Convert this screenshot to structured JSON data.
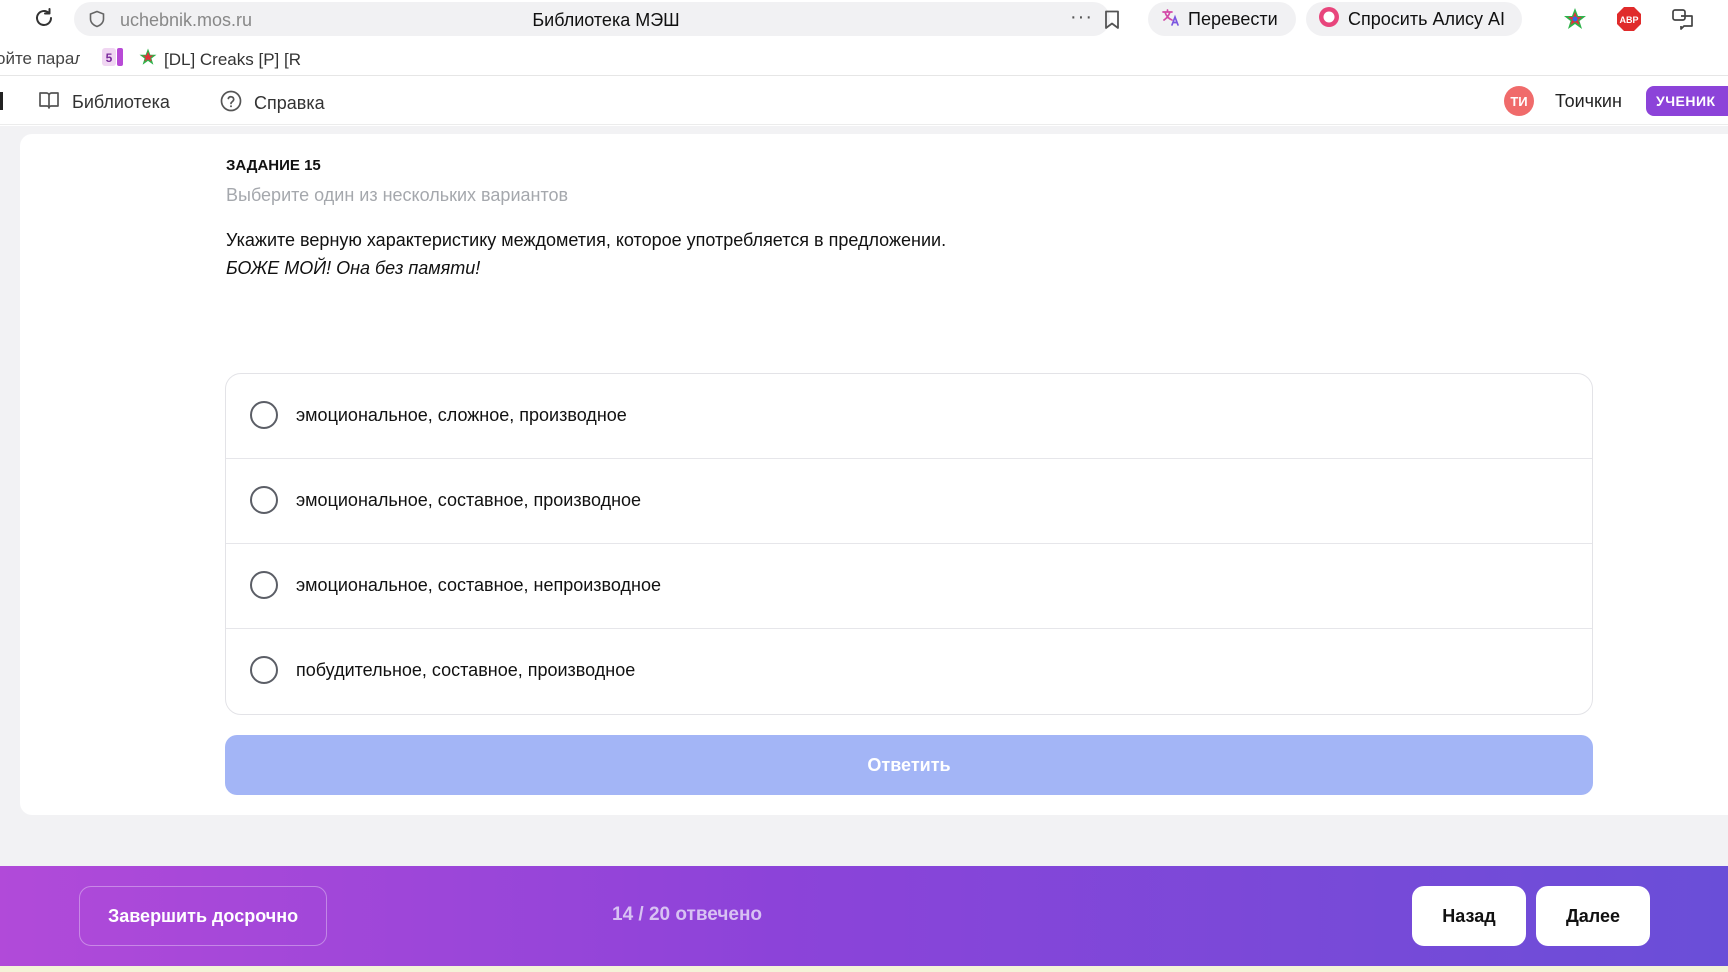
{
  "browser": {
    "url": "uchebnik.mos.ru",
    "tab_title": "Библиотека МЭШ",
    "more_label": "···",
    "translate_label": "Перевести",
    "alice_label": "Спросить Алису AI",
    "icons": [
      "reload-icon",
      "shield-icon",
      "bookmark-icon",
      "translate-icon",
      "alice-icon",
      "star-extension-icon",
      "adblock-icon",
      "profile-extension-icon"
    ],
    "adblock_text": "ABP"
  },
  "bookmarks_bar": {
    "items": [
      {
        "label": "ойте паралл"
      },
      {
        "label": "5"
      },
      {
        "label": "[DL] Creaks [P] [R"
      }
    ]
  },
  "header": {
    "nav": [
      {
        "label": "Библиотека",
        "icon": "book-icon"
      },
      {
        "label": "Справка",
        "icon": "help-icon"
      }
    ],
    "avatar_initials": "ТИ",
    "username": "Тоичкин",
    "role": "УЧЕНИК"
  },
  "task": {
    "label": "ЗАДАНИЕ 15",
    "hint": "Выберите один из нескольких вариантов",
    "question": "Укажите верную характеристику междометия, которое употребляется в предложении.",
    "example": "БОЖЕ МОЙ! Она без памяти!",
    "options": [
      "эмоциональное, сложное, производное",
      "эмоциональное, составное, производное",
      "эмоциональное, составное, непроизводное",
      "побудительное, составное, производное"
    ],
    "submit_label": "Ответить"
  },
  "footer": {
    "finish_label": "Завершить досрочно",
    "progress": "14 / 20 отвечено",
    "back_label": "Назад",
    "next_label": "Далее"
  },
  "colors": {
    "accent_purple": "#8c43d9",
    "submit_disabled": "#a3b5f6",
    "avatar": "#f06b6b"
  }
}
